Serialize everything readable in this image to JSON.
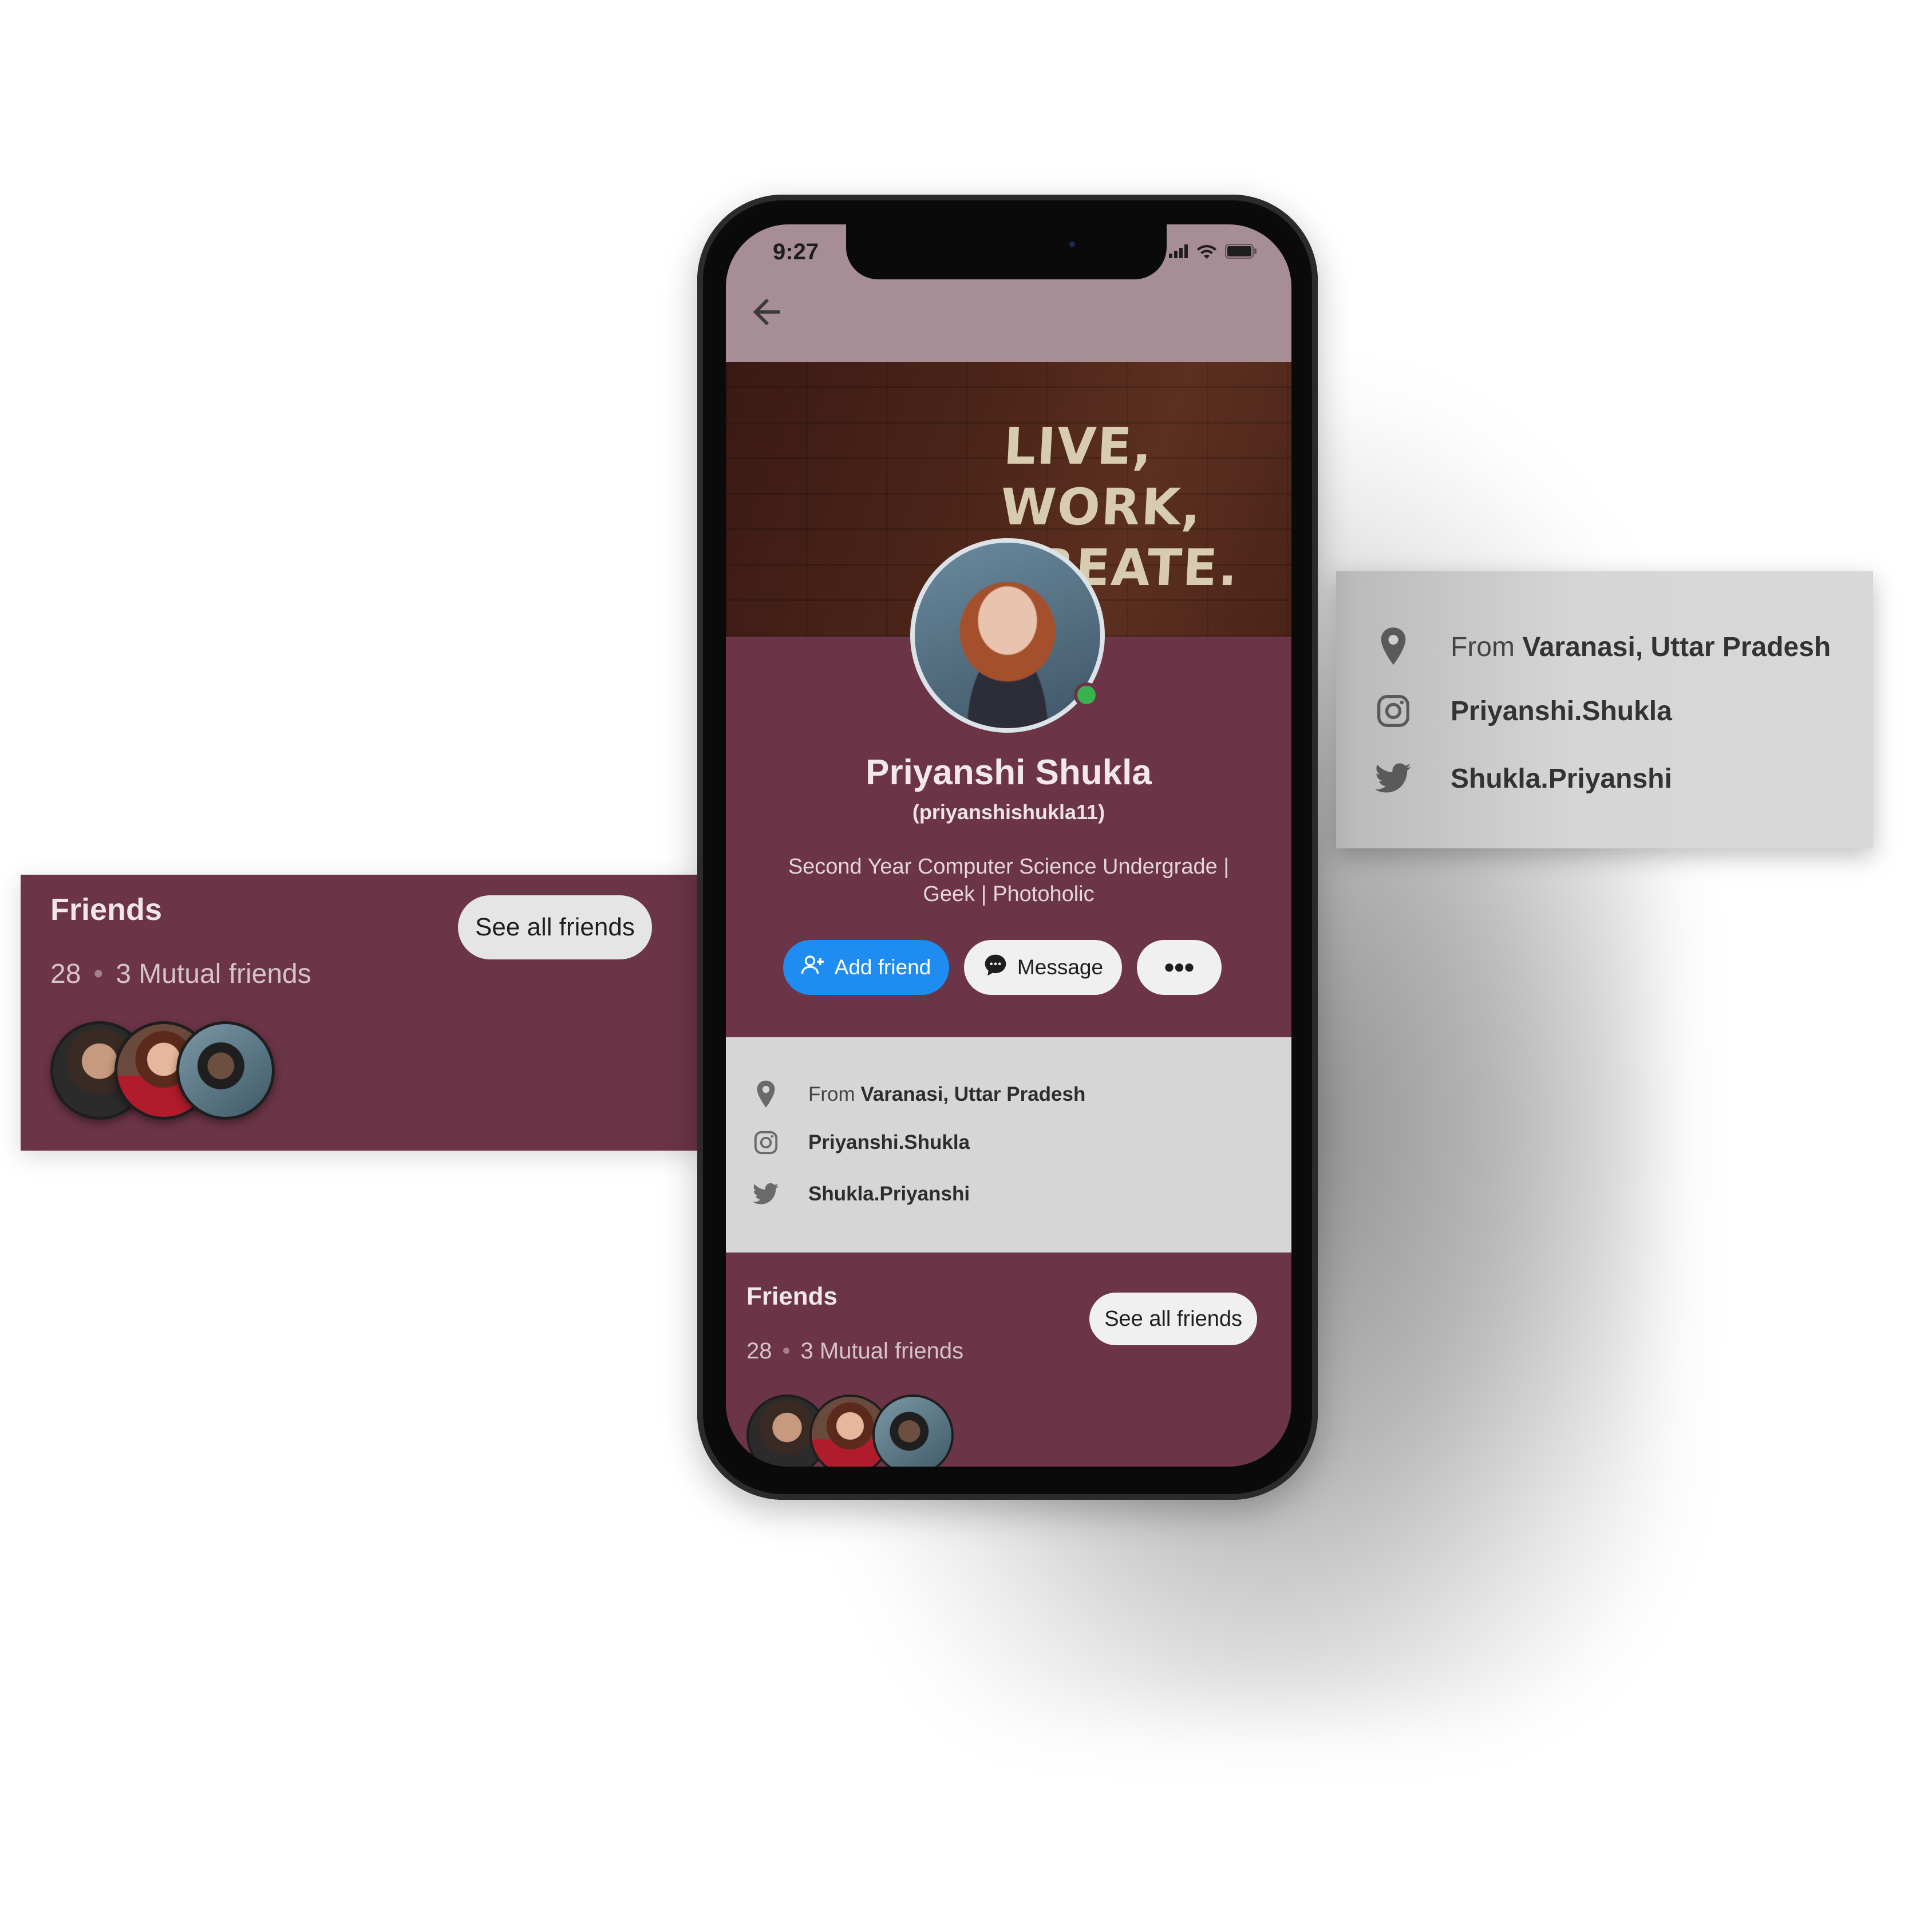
{
  "status_bar": {
    "time": "9:27"
  },
  "cover": {
    "lines": [
      "LIVE,",
      "WORK,",
      "CREATE."
    ]
  },
  "profile": {
    "name": "Priyanshi Shukla",
    "handle": "(priyanshishukla11)",
    "bio": "Second Year Computer Science Undergrade | Geek | Photoholic",
    "online": true
  },
  "actions": {
    "add_friend": "Add friend",
    "message": "Message",
    "more": "•••"
  },
  "info": {
    "from_prefix": "From",
    "location": "Varanasi, Uttar Pradesh",
    "instagram": "Priyanshi.Shukla",
    "twitter": "Shukla.Priyanshi"
  },
  "friends": {
    "title": "Friends",
    "count": "28",
    "mutual": "3 Mutual friends",
    "see_all": "See all friends"
  },
  "colors": {
    "primary": "#6b3447",
    "status_bar": "#a68d96",
    "accent_blue": "#1f8cf2",
    "online_green": "#38b24f",
    "info_bg": "#d6d6d6"
  },
  "icons": [
    "back-arrow-icon",
    "signal-icon",
    "wifi-icon",
    "battery-icon",
    "add-person-icon",
    "chat-bubble-icon",
    "location-pin-icon",
    "instagram-icon",
    "twitter-icon"
  ]
}
